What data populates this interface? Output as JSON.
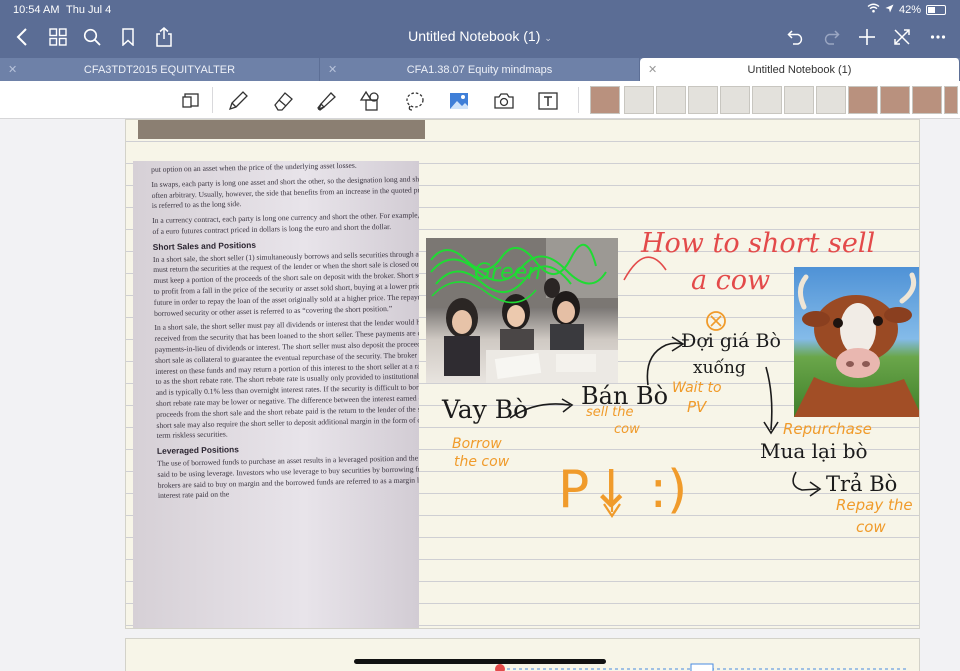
{
  "status_bar": {
    "time": "10:54 AM",
    "date": "Thu Jul 4",
    "battery": "42%"
  },
  "nav": {
    "title": "Untitled Notebook (1)",
    "icons_left": [
      "back-icon",
      "grid-icon",
      "search-icon",
      "bookmark-icon",
      "share-icon"
    ],
    "icons_right": [
      "undo-icon",
      "redo-icon",
      "add-icon",
      "expand-icon",
      "more-icon"
    ]
  },
  "tabs": [
    {
      "label": "CFA3TDT2015 EQUITYALTER",
      "active": false
    },
    {
      "label": "CFA1.38.07 Equity mindmaps",
      "active": false
    },
    {
      "label": "Untitled Notebook (1)",
      "active": true
    }
  ],
  "toolbar": {
    "tools": [
      "reading-mode-icon",
      "pen-icon",
      "eraser-icon",
      "highlighter-icon",
      "shapes-icon",
      "lasso-icon",
      "image-icon",
      "camera-icon",
      "text-icon"
    ],
    "page_thumbnails": 12
  },
  "book_page": {
    "paragraphs": [
      "put option on an asset when the price of the underlying asset losses.",
      "In swaps, each party is long one asset and short the other, so the designation long and short side is often arbitrary. Usually, however, the side that benefits from an increase in the quoted price or rate is referred to as the long side.",
      "In a currency contract, each party is long one currency and short the other. For example, the buyer of a euro futures contract priced in dollars is long the euro and short the dollar."
    ],
    "heading_1": "Short Sales and Positions",
    "section_1": [
      "In a short sale, the short seller (1) simultaneously borrows and sells securities through a broker, (2) must return the securities at the request of the lender or when the short sale is closed out, and (3) must keep a portion of the proceeds of the short sale on deposit with the broker. Short sellers hope to profit from a fall in the price of the security or asset sold short, buying at a lower price in the future in order to repay the loan of the asset originally sold at a higher price. The repayment of the borrowed security or other asset is referred to as “covering the short position.”",
      "In a short sale, the short seller must pay all dividends or interest that the lender would have received from the security that has been loaned to the short seller. These payments are called payments-in-lieu of dividends or interest. The short seller must also deposit the proceeds of the short sale as collateral to guarantee the eventual repurchase of the security. The broker then earns interest on these funds and may return a portion of this interest to the short seller at a rate referred to as the short rebate rate. The short rebate rate is usually only provided to institutional investors and is typically 0.1% less than overnight interest rates. If the security is difficult to borrow, the short rebate rate may be lower or negative. The difference between the interest earned on the proceeds from the short sale and the short rebate paid is the return to the lender of the securities. A short sale may also require the short seller to deposit additional margin in the form of cash or short term riskless securities."
    ],
    "heading_2": "Leveraged Positions",
    "section_2": "The use of borrowed funds to purchase an asset results in a leveraged position and the investor is said to be using leverage. Investors who use leverage to buy securities by borrowing from their brokers are said to buy on margin and the borrowed funds are referred to as a margin loan. The interest rate paid on the"
  },
  "notes": {
    "scribble": "Green",
    "title_line1": "How to short sell",
    "title_line2": "a cow",
    "vay_bo": "Vay Bò",
    "borrow": "Borrow",
    "the_cow": "the cow",
    "ban_bo": "Bán Bò",
    "sell_the": "sell the",
    "cow": "cow",
    "doi_gia": "Đợi giá Bò",
    "xuong": "xuống",
    "wait_to": "Wait to",
    "pv": "PV",
    "repurchase": "Repurchase",
    "mua_lai": "Mua lại bò",
    "tra_bo": "Trả Bò",
    "repay_the": "Repay the",
    "cow2": "cow",
    "big_p": "P↓ :)"
  },
  "colors": {
    "nav": "#5b6d95",
    "tabbar": "#6e81a8",
    "ink_orange": "#f09b2b",
    "ink_red": "#e34a4a",
    "paper": "#f7f5e8"
  }
}
